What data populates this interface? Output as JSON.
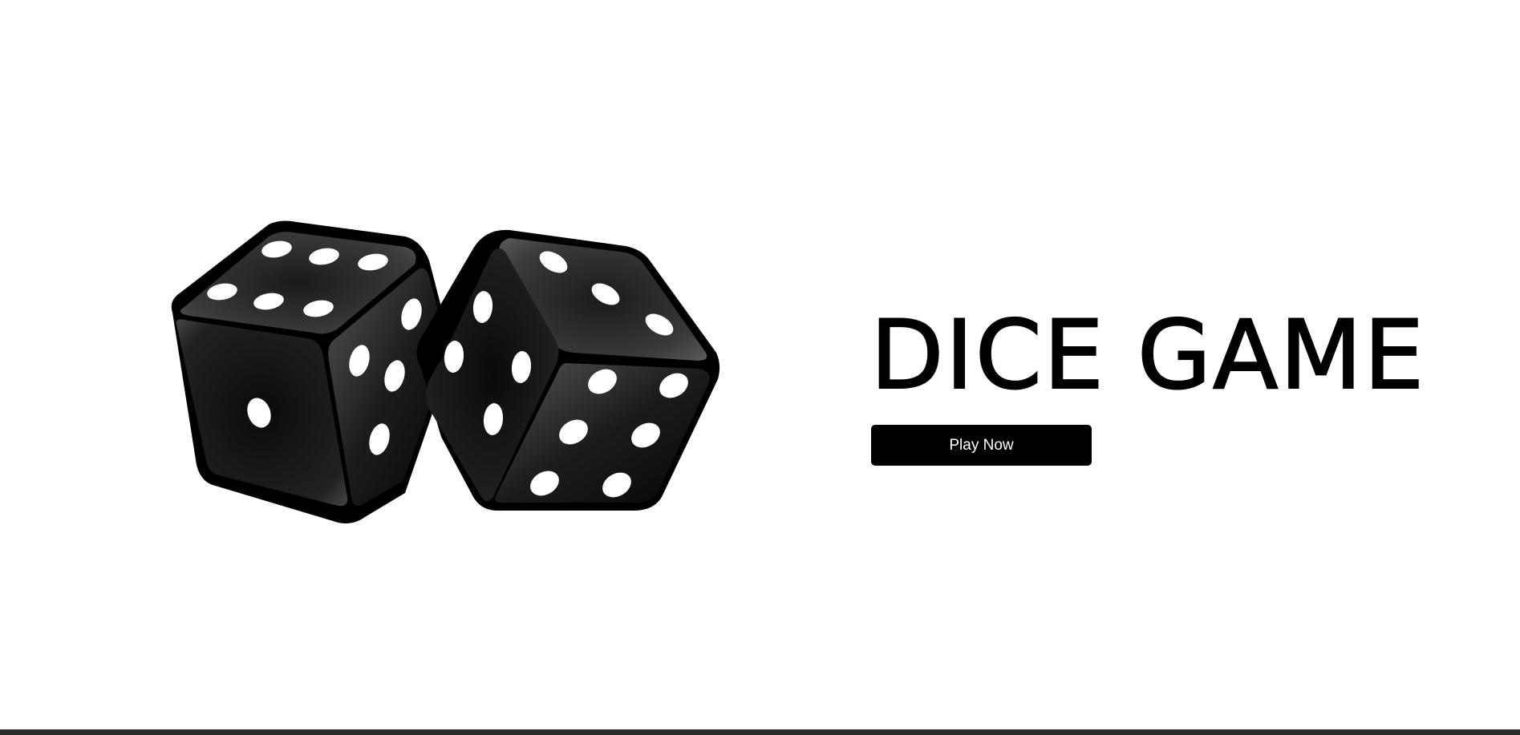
{
  "game": {
    "title": "DICE GAME",
    "play_label": "Play Now"
  },
  "dice_image": {
    "left_die_faces": [
      1,
      5,
      6
    ],
    "right_die_faces": [
      3,
      4,
      6
    ]
  },
  "colors": {
    "background": "#ffffff",
    "text": "#000000",
    "button_bg": "#000000",
    "button_text": "#ffffff",
    "footer_bar": "#2b2b2b"
  }
}
